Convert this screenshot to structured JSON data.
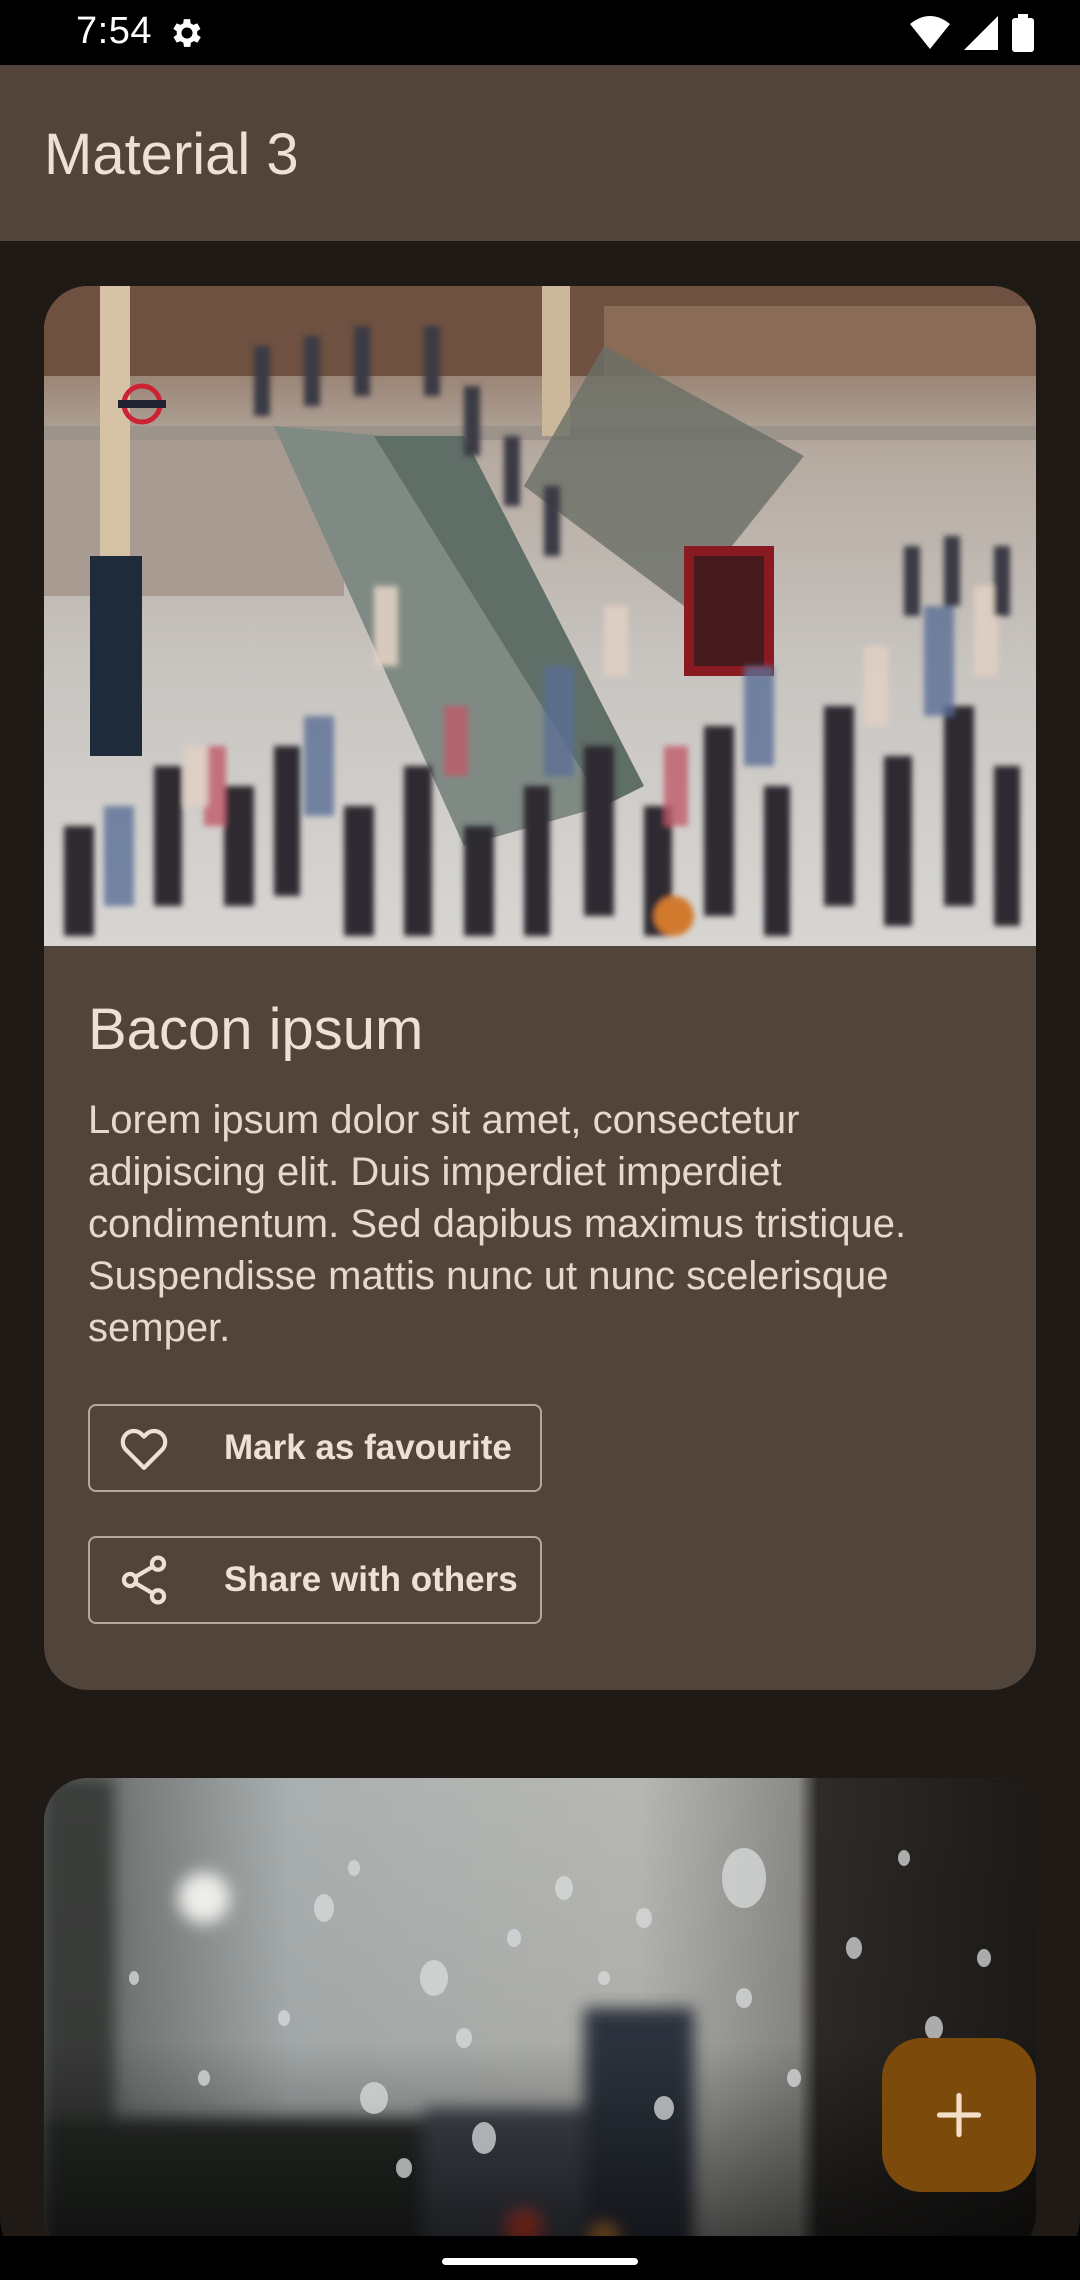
{
  "status_bar": {
    "time": "7:54",
    "icons": [
      "settings-gear-icon",
      "wifi-icon",
      "cellular-signal-icon",
      "battery-icon"
    ]
  },
  "app_bar": {
    "title": "Material 3"
  },
  "cards": [
    {
      "image": "crowded-train-station-escalator-photo",
      "title": "Bacon ipsum",
      "body": "Lorem ipsum dolor sit amet, consectetur adipiscing elit. Duis imperdiet imperdiet condimentum. Sed dapibus maximus tristique. Suspendisse mattis nunc ut nunc scelerisque semper.",
      "buttons": [
        {
          "label": "Mark as favourite",
          "icon": "heart-outline-icon"
        },
        {
          "label": "Share with others",
          "icon": "share-icon"
        }
      ]
    },
    {
      "image": "raindrops-on-window-photo"
    }
  ],
  "fab": {
    "icon": "plus-icon"
  },
  "colors": {
    "background": "#201a17",
    "app_bar": "#52443a",
    "card": "#51443a",
    "on_surface": "#ede0d6",
    "fab": "#7c4a0b",
    "outline": "#b8a799"
  }
}
